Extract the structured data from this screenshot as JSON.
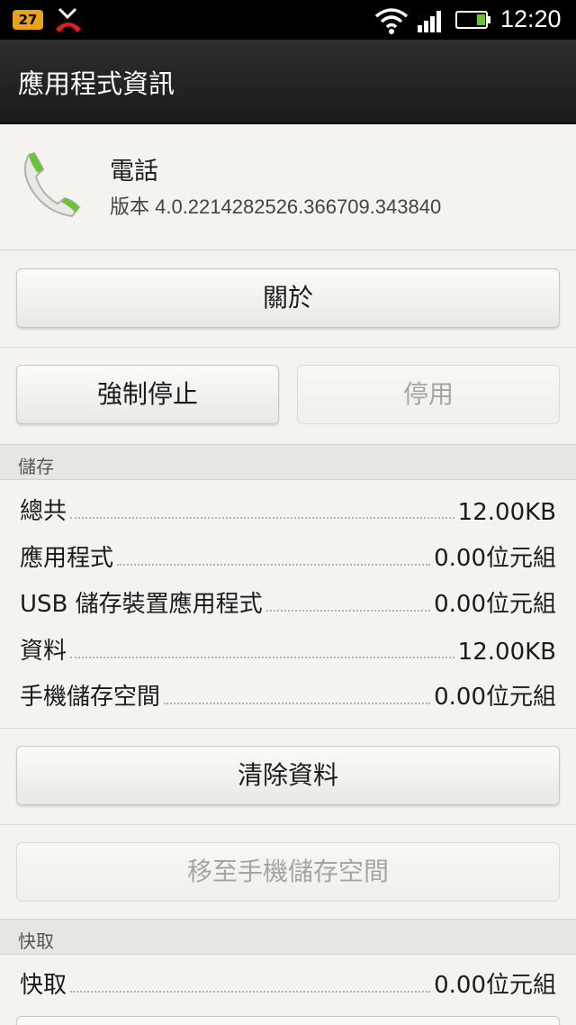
{
  "status_bar": {
    "notification_count": "27",
    "time": "12:20",
    "icons": [
      "notification-badge-icon",
      "missed-call-icon",
      "wifi-icon",
      "signal-icon",
      "battery-icon"
    ]
  },
  "title_bar": {
    "title": "應用程式資訊"
  },
  "app": {
    "name": "電話",
    "version": "版本 4.0.2214282526.366709.343840",
    "icon": "phone-icon"
  },
  "buttons": {
    "about": "關於",
    "force_stop": "強制停止",
    "disable": "停用",
    "clear_data": "清除資料",
    "move_to_phone": "移至手機儲存空間"
  },
  "storage": {
    "header": "儲存",
    "rows": [
      {
        "label": "總共",
        "value": "12.00KB"
      },
      {
        "label": "應用程式",
        "value": "0.00位元組"
      },
      {
        "label": "USB 儲存裝置應用程式",
        "value": "0.00位元組"
      },
      {
        "label": "資料",
        "value": "12.00KB"
      },
      {
        "label": "手機儲存空間",
        "value": "0.00位元組"
      }
    ]
  },
  "cache": {
    "header": "快取",
    "rows": [
      {
        "label": "快取",
        "value": "0.00位元組"
      }
    ]
  },
  "colors": {
    "status_bar": "#000000",
    "title_bar": "#222222",
    "background": "#f4f3ef",
    "notification_badge": "#e8a317",
    "missed_call": "#e02020",
    "phone_icon_green": "#6cc13a"
  }
}
